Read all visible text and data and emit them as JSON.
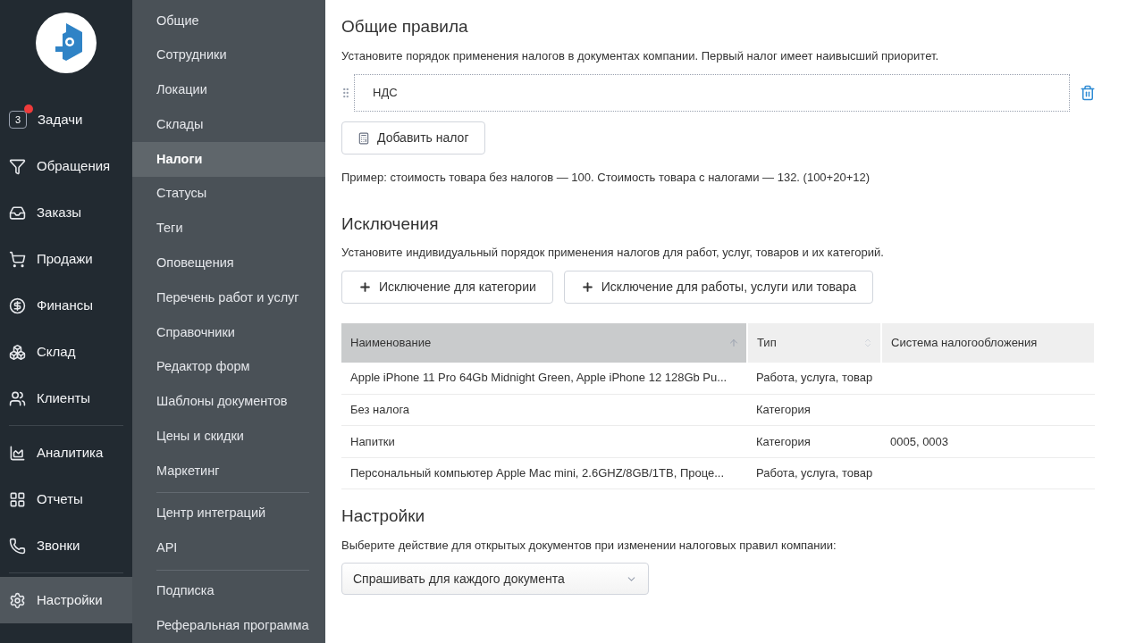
{
  "nav": [
    {
      "kind": "tasks",
      "label": "Задачи",
      "badge": "3",
      "selected": false
    },
    {
      "kind": "filter",
      "label": "Обращения",
      "selected": false
    },
    {
      "kind": "orders",
      "label": "Заказы",
      "selected": false
    },
    {
      "kind": "cart",
      "label": "Продажи",
      "selected": false
    },
    {
      "kind": "money",
      "label": "Финансы",
      "selected": false
    },
    {
      "kind": "boxes",
      "label": "Склад",
      "selected": false
    },
    {
      "kind": "users",
      "label": "Клиенты",
      "selected": false,
      "divider_after": true
    },
    {
      "kind": "chart",
      "label": "Аналитика",
      "selected": false
    },
    {
      "kind": "table",
      "label": "Отчеты",
      "selected": false
    },
    {
      "kind": "phone",
      "label": "Звонки",
      "selected": false,
      "divider_after": true
    },
    {
      "kind": "gear",
      "label": "Настройки",
      "selected": true
    }
  ],
  "submenu": [
    {
      "label": "Общие",
      "selected": false
    },
    {
      "label": "Сотрудники",
      "selected": false
    },
    {
      "label": "Локации",
      "selected": false
    },
    {
      "label": "Склады",
      "selected": false
    },
    {
      "label": "Налоги",
      "selected": true
    },
    {
      "label": "Статусы",
      "selected": false
    },
    {
      "label": "Теги",
      "selected": false
    },
    {
      "label": "Оповещения",
      "selected": false
    },
    {
      "label": "Перечень работ и услуг",
      "selected": false
    },
    {
      "label": "Справочники",
      "selected": false
    },
    {
      "label": "Редактор форм",
      "selected": false
    },
    {
      "label": "Шаблоны документов",
      "selected": false
    },
    {
      "label": "Цены и скидки",
      "selected": false
    },
    {
      "label": "Маркетинг",
      "selected": false,
      "divider_after": true
    },
    {
      "label": "Центр интеграций",
      "selected": false
    },
    {
      "label": "API",
      "selected": false,
      "divider_after": true
    },
    {
      "label": "Подписка",
      "selected": false
    },
    {
      "label": "Реферальная программа",
      "selected": false
    }
  ],
  "general": {
    "title": "Общие правила",
    "description": "Установите порядок применения налогов в документах компании. Первый налог имеет наивысший приоритет.",
    "taxes": [
      "НДС"
    ],
    "add_button": "Добавить налог",
    "example": "Пример: стоимость товара без налогов — 100. Стоимость товара с налогами — 132. (100+20+12)"
  },
  "exceptions": {
    "title": "Исключения",
    "description": "Установите индивидуальный порядок применения налогов для работ, услуг, товаров и их категорий.",
    "buttons": [
      "Исключение для категории",
      "Исключение для работы, услуги или товара"
    ],
    "table": {
      "columns": [
        {
          "label": "Наименование",
          "sorted": true
        },
        {
          "label": "Тип",
          "sorted": false
        },
        {
          "label": "Система налогообложения"
        }
      ],
      "rows": [
        [
          "Apple iPhone 11 Pro 64Gb Midnight Green, Apple iPhone 12 128Gb Pu...",
          "Работа, услуга, товар",
          ""
        ],
        [
          "Без налога",
          "Категория",
          ""
        ],
        [
          "Напитки",
          "Категория",
          "0005, 0003"
        ],
        [
          "Персональный компьютер Apple Mac mini, 2.6GHZ/8GB/1TB, Проце...",
          "Работа, услуга, товар",
          ""
        ]
      ]
    }
  },
  "settings": {
    "title": "Настройки",
    "description": "Выберите действие для открытых документов при изменении налоговых правил компании:",
    "select": "Спрашивать для каждого документа"
  }
}
